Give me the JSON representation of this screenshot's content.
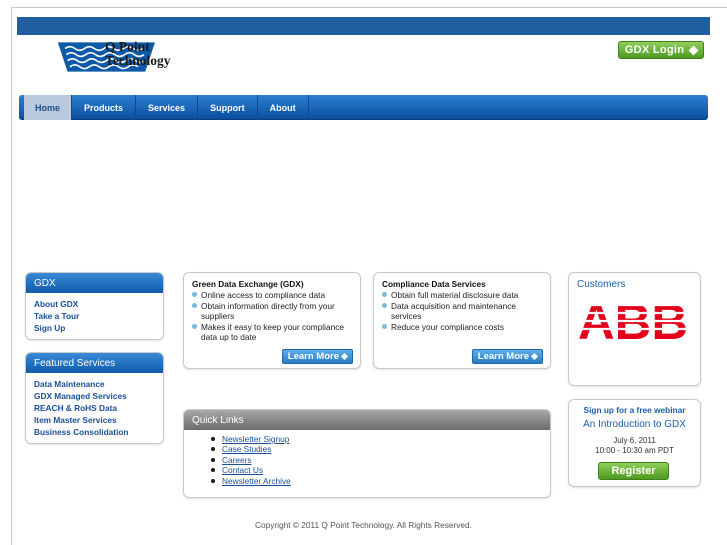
{
  "brand": {
    "name_line1": "Q Point",
    "name_line2": "Technology",
    "accent": "#1f5f9f",
    "green": "#5aa82a"
  },
  "header": {
    "login_label": "GDX Login"
  },
  "nav": {
    "items": [
      {
        "label": "Home"
      },
      {
        "label": "Products"
      },
      {
        "label": "Services"
      },
      {
        "label": "Support"
      },
      {
        "label": "About"
      }
    ]
  },
  "gdx_panel": {
    "title": "GDX",
    "links": [
      {
        "label": "About GDX"
      },
      {
        "label": "Take a Tour"
      },
      {
        "label": "Sign Up"
      }
    ]
  },
  "featured_panel": {
    "title": "Featured Services",
    "links": [
      {
        "label": "Data Maintenance"
      },
      {
        "label": "GDX Managed Services"
      },
      {
        "label": "REACH & RoHS Data"
      },
      {
        "label": "Item Master Services"
      },
      {
        "label": "Business Consolidation"
      }
    ]
  },
  "gdx_card": {
    "title": "Green Data Exchange (GDX)",
    "bullets": [
      "Online access to compliance data",
      "Obtain information directly from your suppliers",
      "Makes it easy to keep your compliance data up to date"
    ],
    "button_label": "Learn More"
  },
  "compliance_card": {
    "title": "Compliance Data Services",
    "bullets": [
      "Obtain full material disclosure data",
      "Data acquisition and maintenance services",
      "Reduce your compliance costs"
    ],
    "button_label": "Learn More"
  },
  "quick_links": {
    "title": "Quick Links",
    "links": [
      {
        "label": "Newsletter Signup"
      },
      {
        "label": "Case Studies"
      },
      {
        "label": "Careers"
      },
      {
        "label": "Contact Us"
      },
      {
        "label": "Newsletter Archive"
      }
    ]
  },
  "customers": {
    "title": "Customers",
    "logo_text": "ABB",
    "logo_color": "#e2001a"
  },
  "webinar": {
    "signup_label": "Sign up for a free webinar",
    "topic": "An Introduction to GDX",
    "date": "July 6, 2011",
    "time": "10:00 - 10:30 am PDT",
    "register_label": "Register"
  },
  "footer": {
    "copyright": "Copyright © 2011 Q Point Technology. All Rights Reserved."
  }
}
